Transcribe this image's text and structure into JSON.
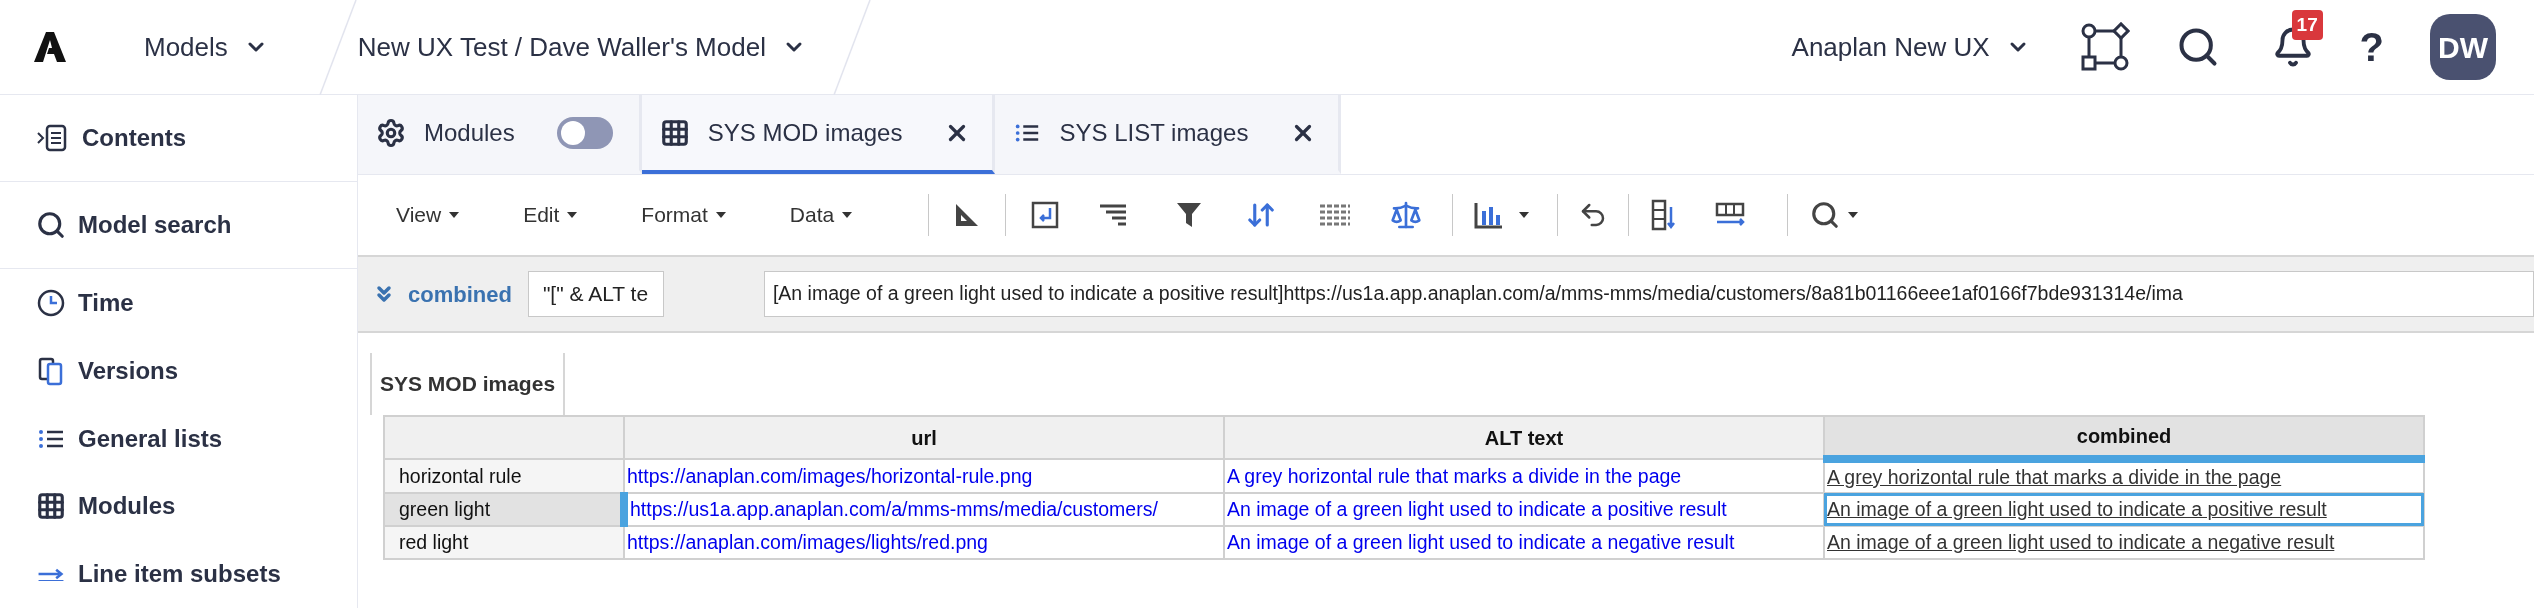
{
  "top_bar": {
    "models_menu": "Models",
    "breadcrumb": "New UX Test / Dave Waller's Model",
    "workspace_menu": "Anaplan New UX",
    "notification_count": "17",
    "help": "?",
    "avatar_initials": "DW"
  },
  "sidebar": {
    "items": [
      {
        "label": "Contents",
        "kind": "contents"
      },
      {
        "label": "Model search",
        "kind": "search"
      },
      {
        "label": "Time",
        "kind": "time"
      },
      {
        "label": "Versions",
        "kind": "versions"
      },
      {
        "label": "General lists",
        "kind": "lists"
      },
      {
        "label": "Modules",
        "kind": "modules"
      },
      {
        "label": "Line item subsets",
        "kind": "subsets"
      }
    ]
  },
  "tabs": [
    {
      "label": "Modules",
      "kind": "toggle",
      "on": false,
      "selected": false
    },
    {
      "label": "SYS MOD images",
      "kind": "module",
      "selected": true
    },
    {
      "label": "SYS LIST images",
      "kind": "list",
      "selected": false
    }
  ],
  "toolbar": {
    "menus": [
      "View",
      "Edit",
      "Format",
      "Data"
    ]
  },
  "formula_bar": {
    "line_item": "combined",
    "formula": "\"[\" & ALT te",
    "value": "[An image of a green light used to indicate a positive result]https://us1a.app.anaplan.com/a/mms-mms/media/customers/8a81b01166eee1af0166f7bde931314e/ima"
  },
  "grid": {
    "title": "SYS MOD images",
    "columns": [
      {
        "label": "url",
        "selected": false
      },
      {
        "label": "ALT text",
        "selected": false
      },
      {
        "label": "combined",
        "selected": true
      }
    ],
    "rows": [
      {
        "label": "horizontal rule",
        "selected": false,
        "cells": [
          "https://anaplan.com/images/horizontal-rule.png",
          "A grey horizontal rule that marks a divide in the page",
          "A grey horizontal rule that marks a divide in the page"
        ]
      },
      {
        "label": "green light",
        "selected": true,
        "cells": [
          "https://us1a.app.anaplan.com/a/mms-mms/media/customers/",
          "An image of a green light used to indicate a positive result",
          "An image of a green light used to indicate a positive result"
        ]
      },
      {
        "label": "red light",
        "selected": false,
        "cells": [
          "https://anaplan.com/images/lights/red.png",
          "An image of a green light used to indicate a negative result",
          "An image of a green light used to indicate a negative result"
        ]
      }
    ]
  }
}
